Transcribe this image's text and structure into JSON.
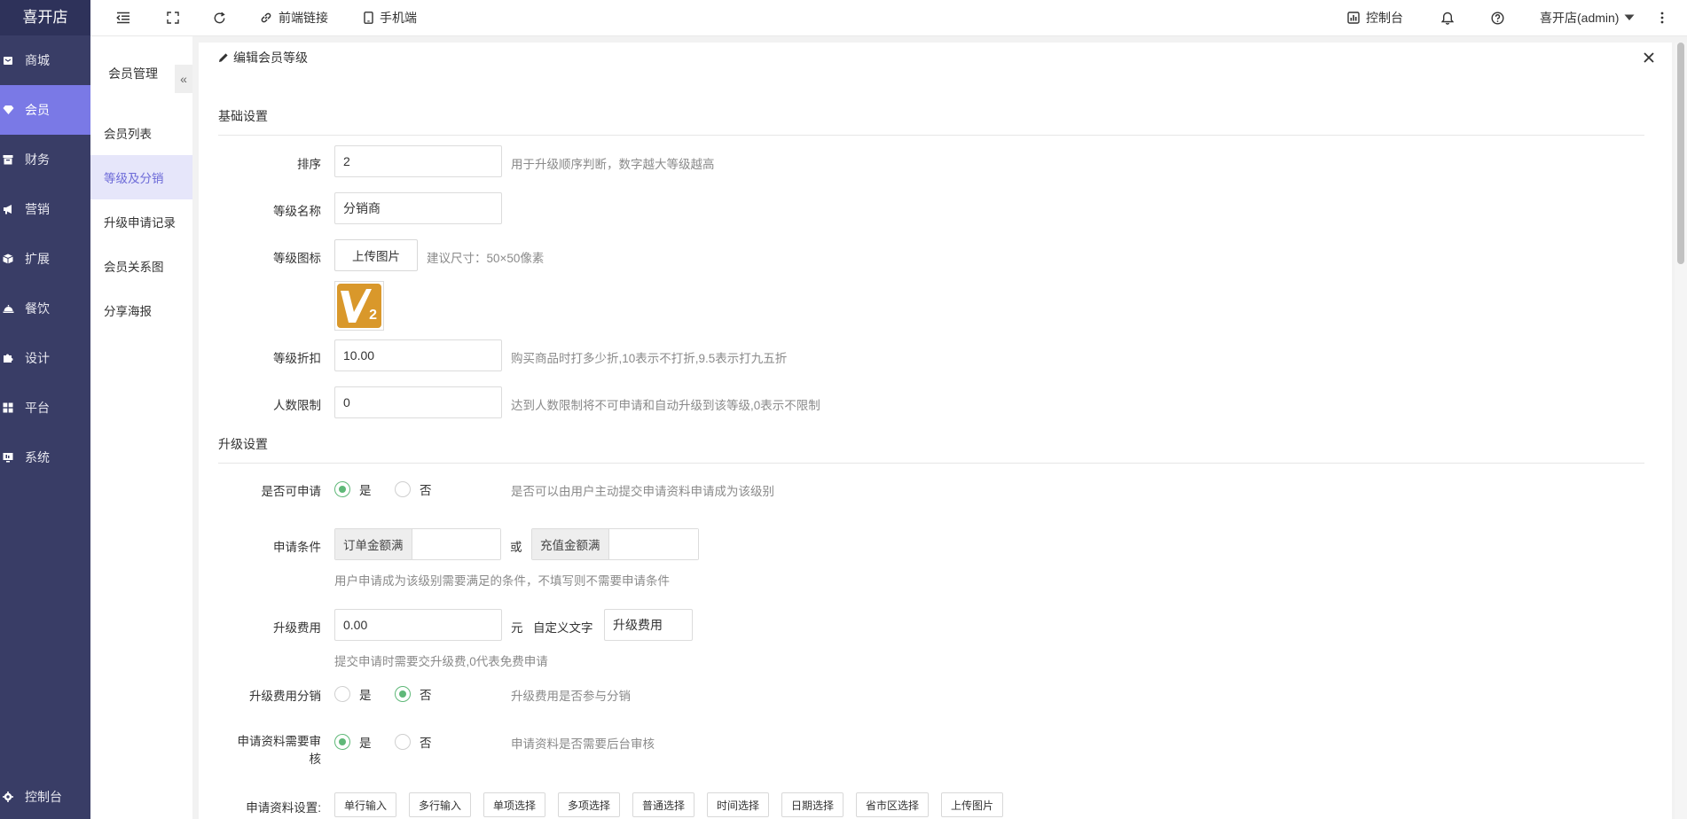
{
  "app": {
    "logo": "喜开店"
  },
  "leftnav": {
    "items": [
      {
        "label": "商城"
      },
      {
        "label": "会员"
      },
      {
        "label": "财务"
      },
      {
        "label": "营销"
      },
      {
        "label": "扩展"
      },
      {
        "label": "餐饮"
      },
      {
        "label": "设计"
      },
      {
        "label": "平台"
      },
      {
        "label": "系统"
      }
    ],
    "active_label": "会员",
    "bottom_label": "控制台"
  },
  "topbar": {
    "frontend_link": "前端链接",
    "mobile": "手机端",
    "console": "控制台",
    "user": "喜开店(admin)"
  },
  "subnav": {
    "title": "会员管理",
    "collapse_glyph": "«",
    "items": [
      {
        "label": "会员列表"
      },
      {
        "label": "等级及分销"
      },
      {
        "label": "升级申请记录"
      },
      {
        "label": "会员关系图"
      },
      {
        "label": "分享海报"
      }
    ],
    "active_label": "等级及分销"
  },
  "panel": {
    "title": "编辑会员等级",
    "basic_section": "基础设置",
    "sort": {
      "label": "排序",
      "value": "2",
      "hint": "用于升级顺序判断，数字越大等级越高"
    },
    "level_name": {
      "label": "等级名称",
      "value": "分销商"
    },
    "level_icon": {
      "label": "等级图标",
      "button": "上传图片",
      "hint": "建议尺寸：50×50像素",
      "badge_text": "2"
    },
    "discount": {
      "label": "等级折扣",
      "value": "10.00",
      "hint": "购买商品时打多少折,10表示不打折,9.5表示打九五折"
    },
    "people_limit": {
      "label": "人数限制",
      "value": "0",
      "hint": "达到人数限制将不可申请和自动升级到该等级,0表示不限制"
    },
    "upgrade_section": "升级设置",
    "can_apply": {
      "label": "是否可申请",
      "yes": "是",
      "no": "否",
      "selected": "yes",
      "hint": "是否可以由用户主动提交申请资料申请成为该级别"
    },
    "apply_condition": {
      "label": "申请条件",
      "order_prefix": "订单金额满",
      "or": "或",
      "recharge_prefix": "充值金额满",
      "hint": "用户申请成为该级别需要满足的条件，不填写则不需要申请条件"
    },
    "upgrade_fee": {
      "label": "升级费用",
      "value": "0.00",
      "unit": "元",
      "custom_label": "自定义文字",
      "custom_value": "升级费用",
      "hint": "提交申请时需要交升级费,0代表免费申请"
    },
    "fee_distribution": {
      "label": "升级费用分销",
      "yes": "是",
      "no": "否",
      "selected": "no",
      "hint": "升级费用是否参与分销"
    },
    "need_review": {
      "label_line1": "申请资料需要审",
      "label_line2": "核",
      "yes": "是",
      "no": "否",
      "selected": "yes",
      "hint": "申请资料是否需要后台审核"
    },
    "apply_fields": {
      "label": "申请资料设置:",
      "chips": [
        "单行输入",
        "多行输入",
        "单项选择",
        "多项选择",
        "普通选择",
        "时间选择",
        "日期选择",
        "省市区选择",
        "上传图片"
      ]
    }
  },
  "colors": {
    "nav_bg": "#393d66",
    "nav_active": "#7a79e6",
    "radio_on": "#5fb878",
    "subnav_active_text": "#6d6bd8"
  }
}
